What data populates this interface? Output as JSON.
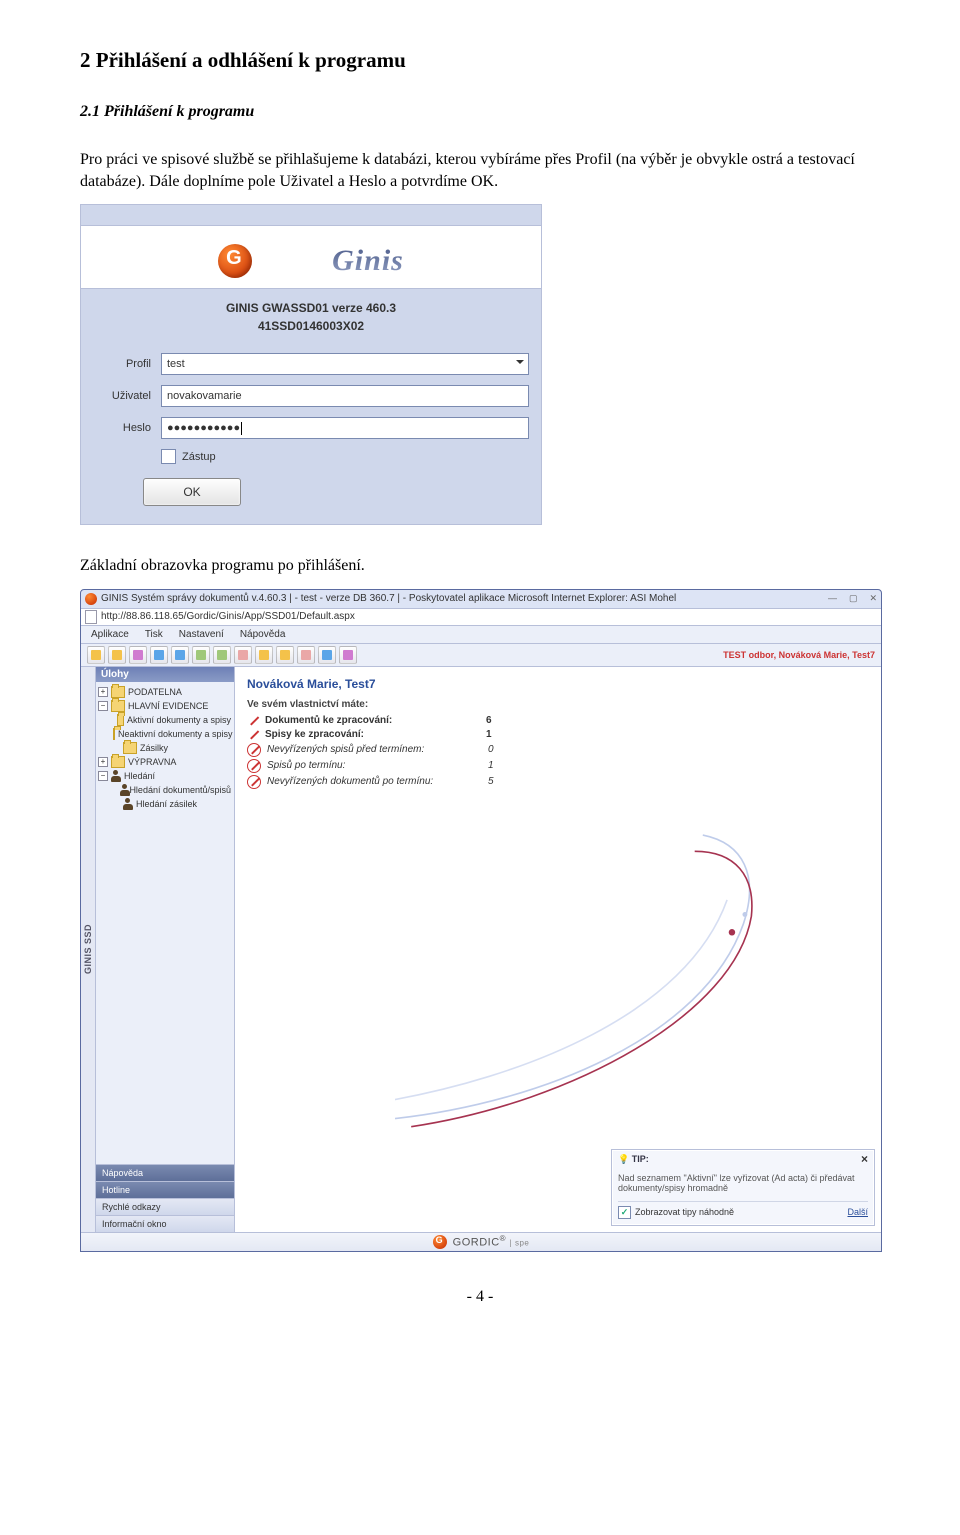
{
  "section_title": "2 Přihlášení a odhlášení k programu",
  "subsection_title": "2.1 Přihlášení k programu",
  "intro_paragraph": "Pro práci ve spisové službě se přihlašujeme k databázi, kterou vybíráme přes Profil (na výběr je obvykle ostrá a testovací databáze). Dále doplníme pole Uživatel a Heslo a potvrdíme OK.",
  "login": {
    "brand": "Ginis",
    "title1": "GINIS GWASSD01 verze 460.3",
    "title2": "41SSD0146003X02",
    "labels": {
      "profil": "Profil",
      "uzivatel": "Uživatel",
      "heslo": "Heslo",
      "zastup": "Zástup"
    },
    "values": {
      "profil": "test",
      "uzivatel": "novakovamarie",
      "heslo": "●●●●●●●●●●●"
    },
    "ok": "OK"
  },
  "mid_text": "Základní obrazovka programu po přihlášení.",
  "main": {
    "win_title": "GINIS Systém správy dokumentů v.4.60.3 | - test - verze DB 360.7 | - Poskytovatel aplikace Microsoft Internet Explorer: ASI Mohel",
    "address": "http://88.86.118.65/Gordic/Ginis/App/SSD01/Default.aspx",
    "menu": [
      "Aplikace",
      "Tisk",
      "Nastavení",
      "Nápověda"
    ],
    "tb_right": "TEST odbor, Nováková Marie, Test7",
    "sidebar_tab": "GINIS   SSD",
    "tree_header": "Úlohy",
    "tree": [
      {
        "expander": "+",
        "icon": "folder",
        "label": "PODATELNA",
        "indent": 0
      },
      {
        "expander": "−",
        "icon": "folder",
        "label": "HLAVNÍ EVIDENCE",
        "indent": 0
      },
      {
        "expander": "",
        "icon": "folder",
        "label": "Aktivní dokumenty a spisy",
        "indent": 1
      },
      {
        "expander": "",
        "icon": "folder",
        "label": "Neaktivní dokumenty a spisy",
        "indent": 1
      },
      {
        "expander": "",
        "icon": "folder",
        "label": "Zásilky",
        "indent": 1
      },
      {
        "expander": "+",
        "icon": "folder",
        "label": "VÝPRAVNA",
        "indent": 0
      },
      {
        "expander": "−",
        "icon": "person",
        "label": "Hledání",
        "indent": 0
      },
      {
        "expander": "",
        "icon": "person",
        "label": "Hledání dokumentů/spisů",
        "indent": 1
      },
      {
        "expander": "",
        "icon": "person",
        "label": "Hledání zásilek",
        "indent": 1
      }
    ],
    "bottom_tabs": [
      "Nápověda",
      "Hotline",
      "Rychlé odkazy",
      "Informační okno"
    ],
    "content": {
      "user": "Nováková Marie, Test7",
      "own_header": "Ve svém vlastnictví máte:",
      "rows": [
        {
          "icon": false,
          "bold": true,
          "label": "Dokumentů ke zpracování:",
          "value": "6"
        },
        {
          "icon": false,
          "bold": true,
          "label": "Spisy ke zpracování:",
          "value": "1"
        },
        {
          "icon": true,
          "bold": false,
          "label": "Nevyřízených spisů před termínem:",
          "value": "0"
        },
        {
          "icon": true,
          "bold": false,
          "label": "Spisů po termínu:",
          "value": "1"
        },
        {
          "icon": true,
          "bold": false,
          "label": "Nevyřízených dokumentů po termínu:",
          "value": "5"
        }
      ]
    },
    "tip": {
      "head": "TIP:",
      "body": "Nad seznamem \"Aktivní\" lze vyřizovat (Ad acta) či předávat dokumenty/spisy hromadně",
      "chk_label": "Zobrazovat tipy náhodně",
      "link": "Další"
    },
    "status_brand": "GORDIC",
    "status_suffix": "spe"
  },
  "page_number": "- 4 -"
}
